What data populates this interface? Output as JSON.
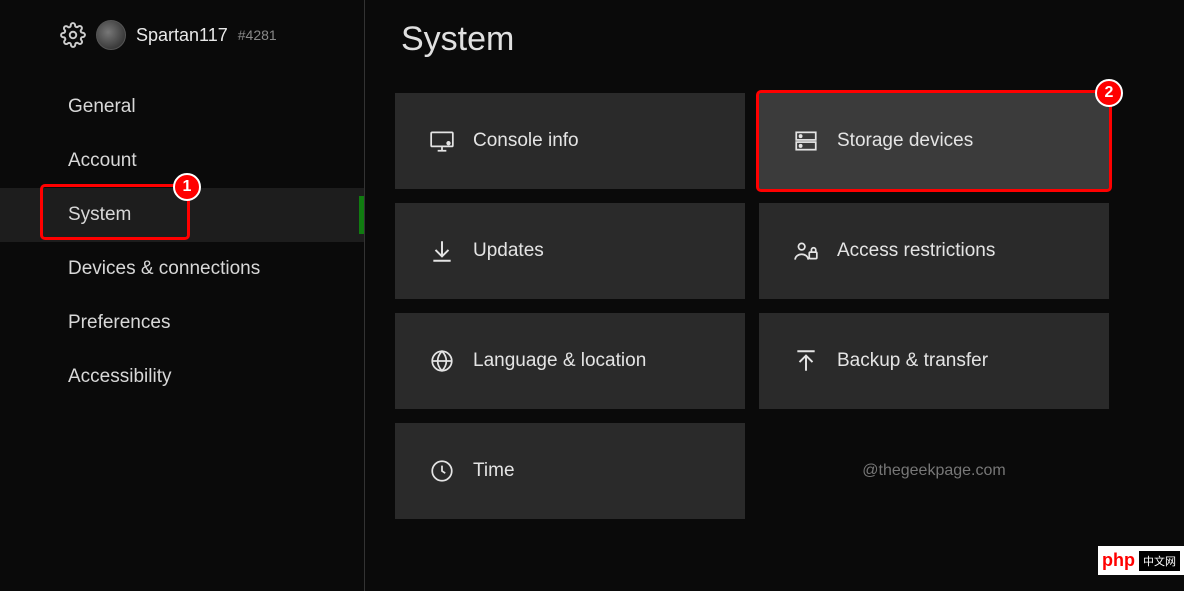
{
  "profile": {
    "username": "Spartan117",
    "tag": "#4281"
  },
  "sidebar": {
    "items": [
      {
        "label": "General"
      },
      {
        "label": "Account"
      },
      {
        "label": "System"
      },
      {
        "label": "Devices & connections"
      },
      {
        "label": "Preferences"
      },
      {
        "label": "Accessibility"
      }
    ]
  },
  "page": {
    "title": "System"
  },
  "tiles": [
    {
      "label": "Console info"
    },
    {
      "label": "Storage devices"
    },
    {
      "label": "Updates"
    },
    {
      "label": "Access restrictions"
    },
    {
      "label": "Language & location"
    },
    {
      "label": "Backup & transfer"
    },
    {
      "label": "Time"
    }
  ],
  "annotations": {
    "badge1": "1",
    "badge2": "2"
  },
  "watermark": "@thegeekpage.com",
  "php_badge": {
    "text": "php",
    "cn": "中文网"
  }
}
